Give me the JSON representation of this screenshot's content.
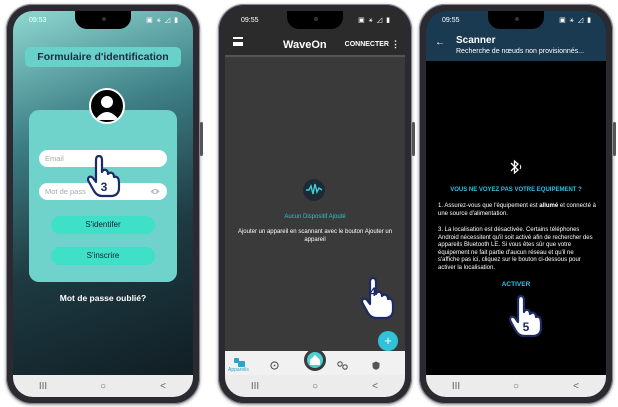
{
  "phones": [
    {
      "status_time": "09:53",
      "status_icons": "▣ ⚹ ◿ ▮",
      "title": "Formulaire d'identification",
      "email_placeholder": "Email",
      "password_placeholder": "Mot de pass",
      "eye_icon": "eye-icon",
      "login_button": "S'identifer",
      "register_button": "S'inscrire",
      "forgot_password": "Mot de passe oublié?",
      "step_number": "3",
      "nav": [
        "III",
        "○",
        "<"
      ]
    },
    {
      "status_time": "09:55",
      "status_icons": "▣ ⚹ ◿ ▮",
      "app_title": "WaveOn",
      "connect_button": "CONNECTER",
      "menu_kebab": "⋮",
      "empty_title": "Aucun Dispositif Ajouté",
      "empty_hint": "Ajouter un appareil en scannant avec le bouton Ajouter un appareil",
      "fab_label": "+",
      "tab_devices": "Appareils",
      "step_number": "4",
      "nav": [
        "III",
        "○",
        "<"
      ]
    },
    {
      "status_time": "09:55",
      "status_icons": "▣ ⚹ ◿ ▮",
      "title": "Scanner",
      "subtitle": "Recherche de nœuds non provisionnés...",
      "heading": "VOUS NE VOYEZ PAS VOTRE EQUIPEMENT ?",
      "para1": "1. Assurez-vous que l'équipement est allumé et connecté à une source d'alimentation.",
      "para1_bold": "allumé",
      "para2": "3. La localisation est désactivée. Certains téléphones Android nécessitent qu'il soit activé afin de rechercher des appareils Bluetooth LE. Si vous êtes sûr que votre équipement ne fait partie d'aucun réseau et qu'il ne s'affiche pas ici, cliquez sur le bouton ci-dessous pour activer la localisation.",
      "activate_button": "ACTIVER",
      "step_number": "5",
      "nav": [
        "III",
        "○",
        "<"
      ]
    }
  ]
}
